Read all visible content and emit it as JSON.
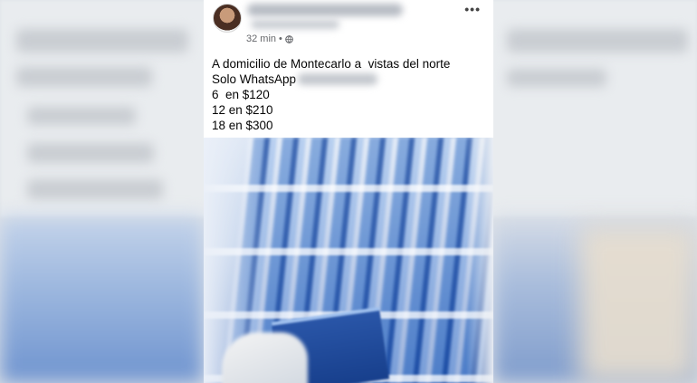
{
  "post": {
    "timestamp": "32 min",
    "separator": "•",
    "more_label": "•••",
    "lines": [
      "A domicilio de Montecarlo a  vistas del norte",
      "Solo WhatsApp",
      "6  en $120",
      "12 en $210",
      "18 en $300"
    ],
    "photo_icon": "water-bottle-packs-photo"
  }
}
